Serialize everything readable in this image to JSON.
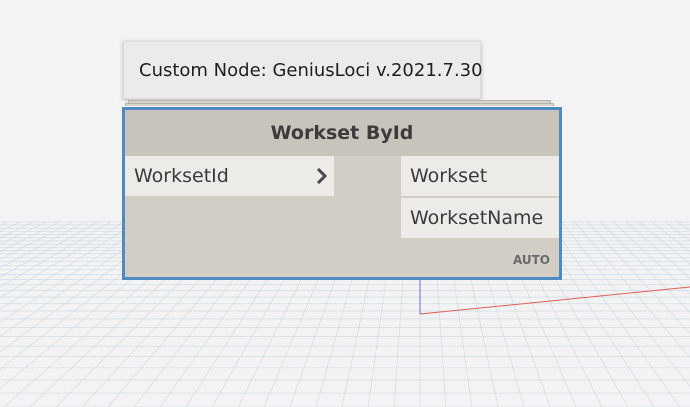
{
  "tooltip": {
    "text": "Custom Node: GeniusLoci v.2021.7.30"
  },
  "node": {
    "title": "Workset ById",
    "inputs": [
      {
        "label": "WorksetId"
      }
    ],
    "outputs": [
      {
        "label": "Workset"
      },
      {
        "label": "WorksetName"
      }
    ],
    "lacing": "AUTO"
  },
  "colors": {
    "background": "#f3f3f3",
    "grid_line": "#c9d8e2",
    "selection_border": "#4f8bc1",
    "node_body": "#d2cec6",
    "node_header": "#c8c3bb",
    "port_background": "#ecebe8",
    "axis_x": "#e0605a",
    "axis_y": "#6b6bd8"
  },
  "icons": {
    "input_port": "chevron-right-icon"
  }
}
